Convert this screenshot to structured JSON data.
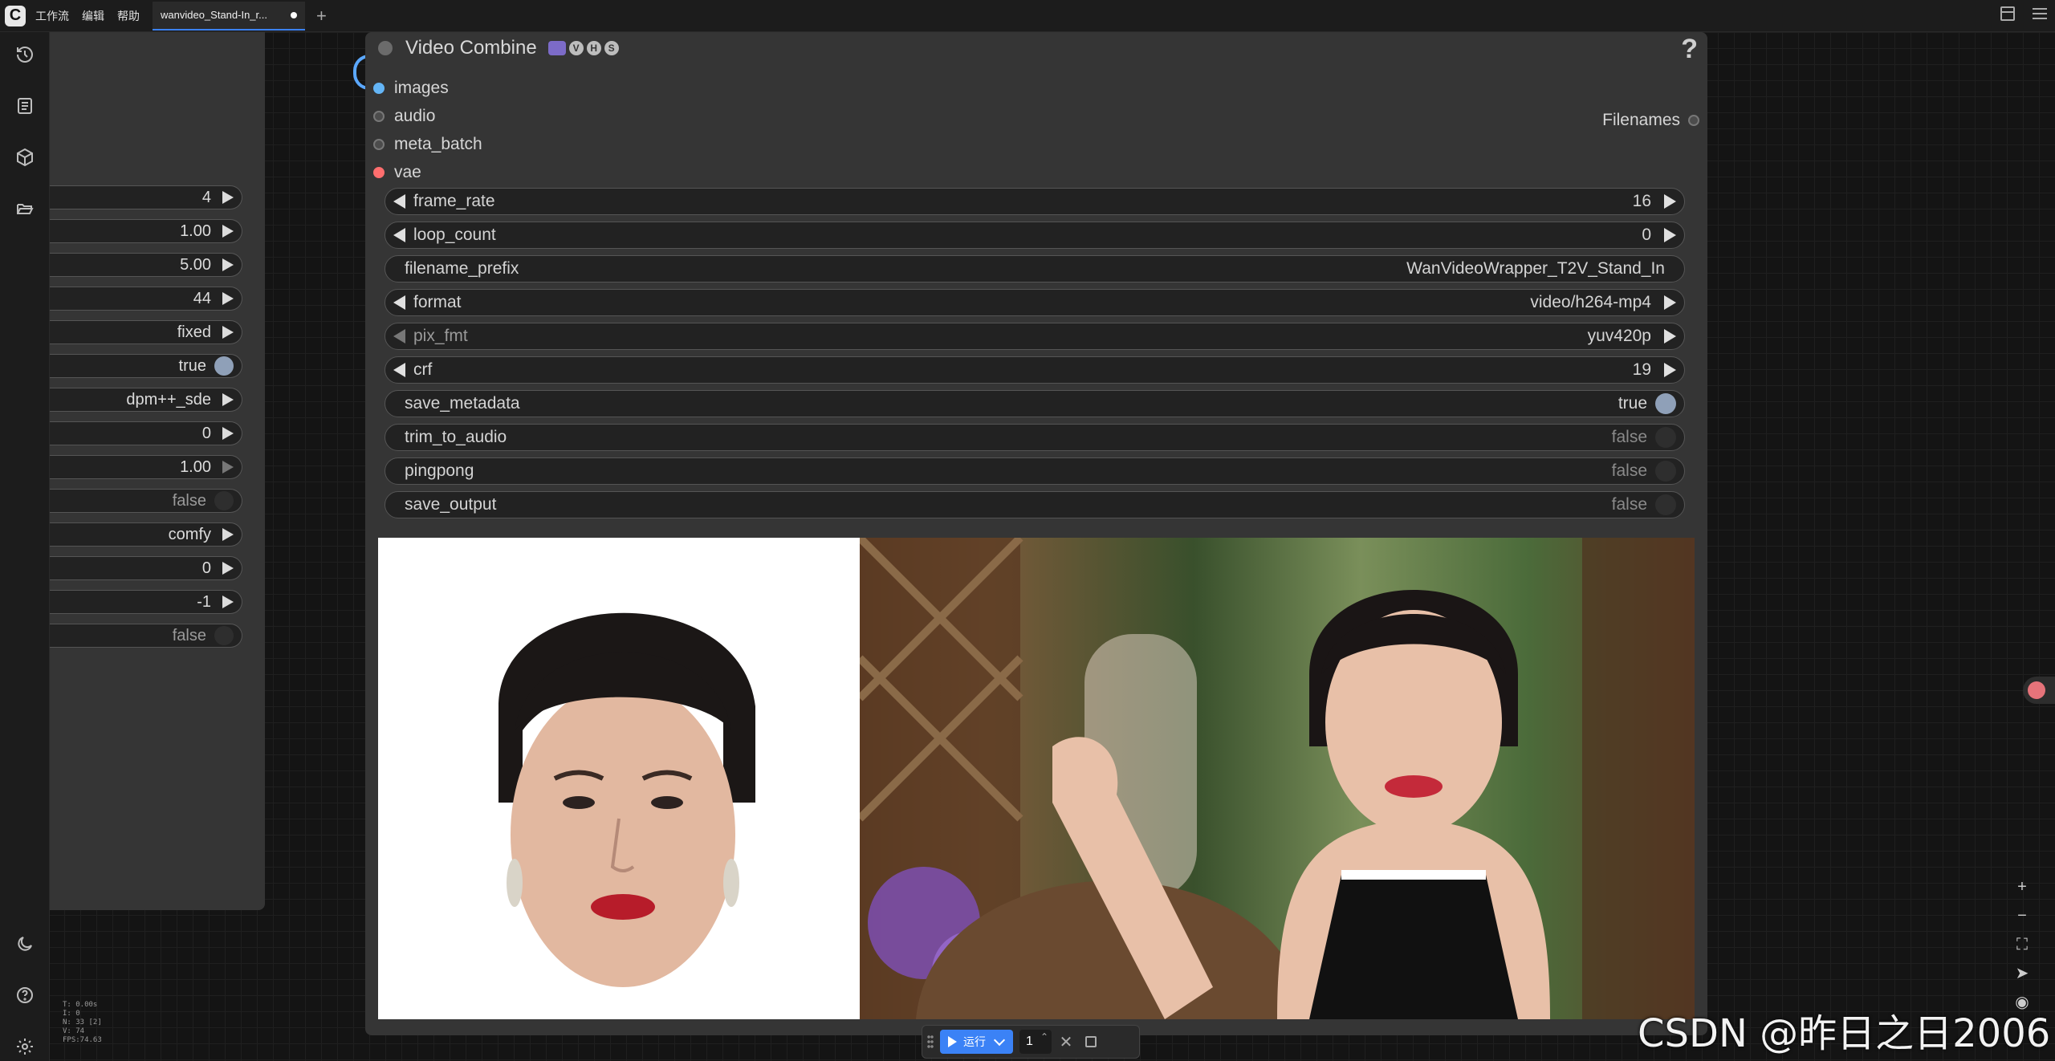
{
  "topbar": {
    "menu": [
      "工作流",
      "编辑",
      "帮助"
    ],
    "tab_title": "wanvideo_Stand-In_r..."
  },
  "sidebar": {
    "icons": [
      "history-icon",
      "document-icon",
      "cube-icon",
      "folder-open-icon",
      "moon-icon",
      "help-circle-icon",
      "settings-icon"
    ]
  },
  "left_node": {
    "widgets": [
      {
        "value": "4",
        "kind": "number"
      },
      {
        "value": "1.00",
        "kind": "number"
      },
      {
        "value": "5.00",
        "kind": "number"
      },
      {
        "value": "44",
        "kind": "number"
      },
      {
        "value": "fixed",
        "kind": "combo"
      },
      {
        "value": "true",
        "kind": "toggle-on"
      },
      {
        "value": "dpm++_sde",
        "kind": "combo"
      },
      {
        "value": "0",
        "kind": "number"
      },
      {
        "value": "1.00",
        "kind": "number-dim"
      },
      {
        "value": "false",
        "kind": "toggle-off"
      },
      {
        "value": "comfy",
        "kind": "combo"
      },
      {
        "value": "0",
        "kind": "number"
      },
      {
        "value": "-1",
        "kind": "number"
      },
      {
        "value": "false",
        "kind": "toggle-off"
      }
    ]
  },
  "node": {
    "title": "Video Combine",
    "badges": [
      "V",
      "H",
      "S"
    ],
    "help": "?",
    "inputs": [
      "images",
      "audio",
      "meta_batch",
      "vae"
    ],
    "output": "Filenames",
    "widgets": [
      {
        "label": "frame_rate",
        "value": "16",
        "kind": "number"
      },
      {
        "label": "loop_count",
        "value": "0",
        "kind": "number"
      },
      {
        "label": "filename_prefix",
        "value": "WanVideoWrapper_T2V_Stand_In",
        "kind": "text"
      },
      {
        "label": "format",
        "value": "video/h264-mp4",
        "kind": "combo"
      },
      {
        "label": "pix_fmt",
        "value": "yuv420p",
        "kind": "combo-dim"
      },
      {
        "label": "crf",
        "value": "19",
        "kind": "number"
      },
      {
        "label": "save_metadata",
        "value": "true",
        "kind": "toggle-on"
      },
      {
        "label": "trim_to_audio",
        "value": "false",
        "kind": "toggle-off"
      },
      {
        "label": "pingpong",
        "value": "false",
        "kind": "toggle-off"
      },
      {
        "label": "save_output",
        "value": "false",
        "kind": "toggle-off"
      }
    ]
  },
  "runbar": {
    "run_label": "运行",
    "batch_count": "1"
  },
  "stats": [
    "T: 0.00s",
    "I: 0",
    "N: 33 [2]",
    "V: 74",
    "FPS:74.63"
  ],
  "watermark": "CSDN @昨日之日2006"
}
